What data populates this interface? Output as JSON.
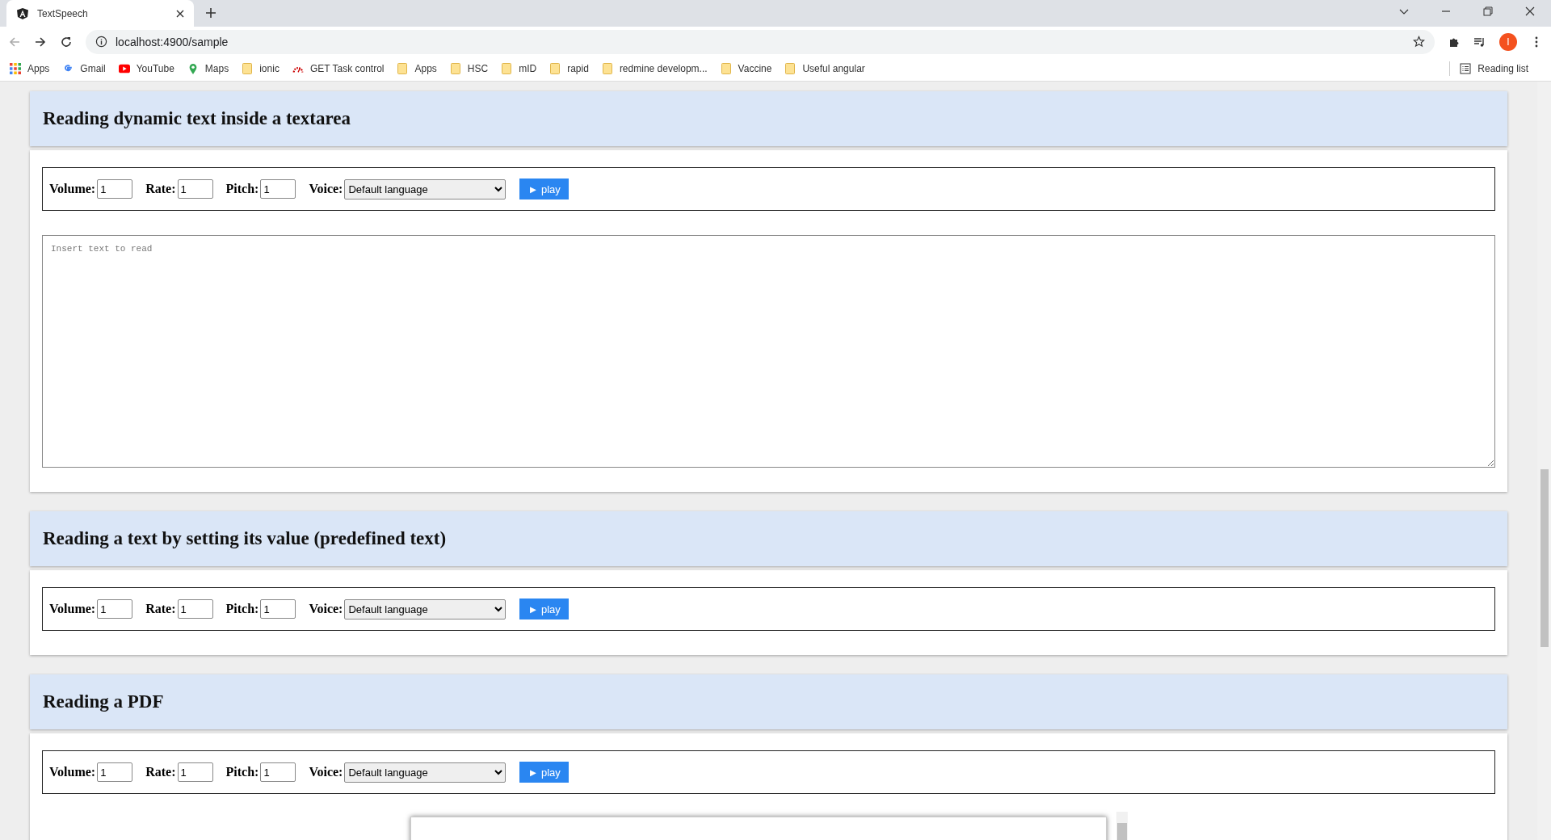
{
  "browser": {
    "tab_title": "TextSpeech",
    "url": "localhost:4900/sample",
    "profile_initial": "I",
    "reading_list": "Reading list",
    "bookmarks": [
      {
        "label": "Apps",
        "kind": "apps"
      },
      {
        "label": "Gmail",
        "kind": "gmail"
      },
      {
        "label": "YouTube",
        "kind": "youtube"
      },
      {
        "label": "Maps",
        "kind": "maps"
      },
      {
        "label": "ionic",
        "kind": "folder"
      },
      {
        "label": "GET Task control",
        "kind": "gauge"
      },
      {
        "label": "Apps",
        "kind": "folder"
      },
      {
        "label": "HSC",
        "kind": "folder"
      },
      {
        "label": "mID",
        "kind": "folder"
      },
      {
        "label": "rapid",
        "kind": "folder"
      },
      {
        "label": "redmine developm...",
        "kind": "folder"
      },
      {
        "label": "Vaccine",
        "kind": "folder"
      },
      {
        "label": "Useful angular",
        "kind": "folder"
      }
    ]
  },
  "sections": [
    {
      "title": "Reading dynamic text inside a textarea",
      "kind": "textarea",
      "placeholder": "Insert text to read",
      "controls": [
        {
          "kind": "number",
          "label": "Volume:",
          "value": "1"
        },
        {
          "kind": "number",
          "label": "Rate:",
          "value": "1"
        },
        {
          "kind": "number",
          "label": "Pitch:",
          "value": "1"
        },
        {
          "kind": "select",
          "label": "Voice:",
          "value": "Default language"
        },
        {
          "kind": "button",
          "label": "► play"
        }
      ]
    },
    {
      "title": "Reading a text by setting its value (predefined text)",
      "kind": "plain",
      "controls": [
        {
          "kind": "number",
          "label": "Volume:",
          "value": "1"
        },
        {
          "kind": "number",
          "label": "Rate:",
          "value": "1"
        },
        {
          "kind": "number",
          "label": "Pitch:",
          "value": "1"
        },
        {
          "kind": "select",
          "label": "Voice:",
          "value": "Default language"
        },
        {
          "kind": "button",
          "label": "► play"
        }
      ]
    },
    {
      "title": "Reading a PDF",
      "kind": "pdf",
      "controls": [
        {
          "kind": "number",
          "label": "Volume:",
          "value": "1"
        },
        {
          "kind": "number",
          "label": "Rate:",
          "value": "1"
        },
        {
          "kind": "number",
          "label": "Pitch:",
          "value": "1"
        },
        {
          "kind": "select",
          "label": "Voice:",
          "value": "Default language"
        },
        {
          "kind": "button",
          "label": "► play"
        }
      ]
    }
  ]
}
